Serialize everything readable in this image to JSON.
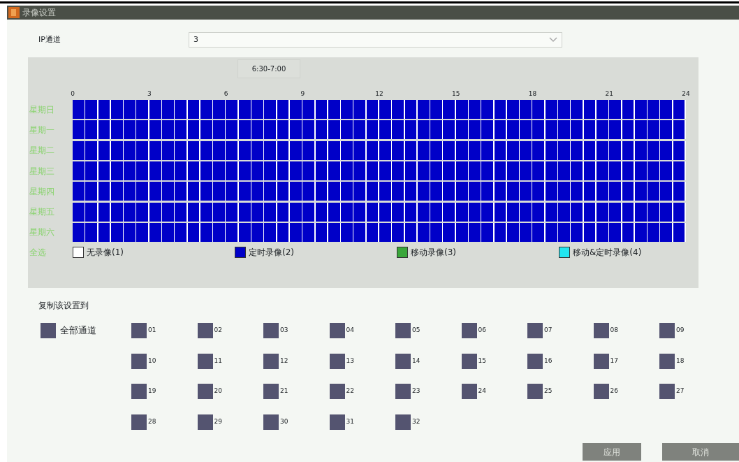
{
  "window": {
    "title": "录像设置"
  },
  "ip_channel": {
    "label": "IP通道",
    "value": "3"
  },
  "schedule": {
    "tooltip": "6:30-7:00",
    "ticks": [
      "0",
      "3",
      "6",
      "9",
      "12",
      "15",
      "18",
      "21",
      "24"
    ],
    "days": [
      {
        "label": "星期日",
        "kind": "timed"
      },
      {
        "label": "星期一",
        "kind": "timed"
      },
      {
        "label": "星期二",
        "kind": "timed"
      },
      {
        "label": "星期三",
        "kind": "timed"
      },
      {
        "label": "星期四",
        "kind": "timed"
      },
      {
        "label": "星期五",
        "kind": "timed"
      },
      {
        "label": "星期六",
        "kind": "timed"
      }
    ],
    "select_all": "全选",
    "legend": [
      {
        "kind": "none",
        "label": "无录像(1)",
        "color": "#ffffff"
      },
      {
        "kind": "timed",
        "label": "定时录像(2)",
        "color": "#0000c8"
      },
      {
        "kind": "motion",
        "label": "移动录像(3)",
        "color": "#3aa63a"
      },
      {
        "kind": "motion_timed",
        "label": "移动&定时录像(4)",
        "color": "#22e6f0"
      }
    ]
  },
  "copy_to": {
    "label": "复制该设置到",
    "all_channels": {
      "label": "全部通道",
      "checked": false
    },
    "channels": [
      {
        "label": "01",
        "checked": false
      },
      {
        "label": "02",
        "checked": false
      },
      {
        "label": "03",
        "checked": false
      },
      {
        "label": "04",
        "checked": false
      },
      {
        "label": "05",
        "checked": false
      },
      {
        "label": "06",
        "checked": false
      },
      {
        "label": "07",
        "checked": false
      },
      {
        "label": "08",
        "checked": false
      },
      {
        "label": "09",
        "checked": false
      },
      {
        "label": "10",
        "checked": false
      },
      {
        "label": "11",
        "checked": false
      },
      {
        "label": "12",
        "checked": false
      },
      {
        "label": "13",
        "checked": false
      },
      {
        "label": "14",
        "checked": false
      },
      {
        "label": "15",
        "checked": false
      },
      {
        "label": "16",
        "checked": false
      },
      {
        "label": "17",
        "checked": false
      },
      {
        "label": "18",
        "checked": false
      },
      {
        "label": "19",
        "checked": false
      },
      {
        "label": "20",
        "checked": false
      },
      {
        "label": "21",
        "checked": false
      },
      {
        "label": "22",
        "checked": false
      },
      {
        "label": "23",
        "checked": false
      },
      {
        "label": "24",
        "checked": false
      },
      {
        "label": "25",
        "checked": false
      },
      {
        "label": "26",
        "checked": false
      },
      {
        "label": "27",
        "checked": false
      },
      {
        "label": "28",
        "checked": false
      },
      {
        "label": "29",
        "checked": false
      },
      {
        "label": "30",
        "checked": false
      },
      {
        "label": "31",
        "checked": false
      },
      {
        "label": "32",
        "checked": false
      }
    ]
  },
  "buttons": [
    {
      "label": "应用"
    },
    {
      "label": "取消"
    }
  ]
}
